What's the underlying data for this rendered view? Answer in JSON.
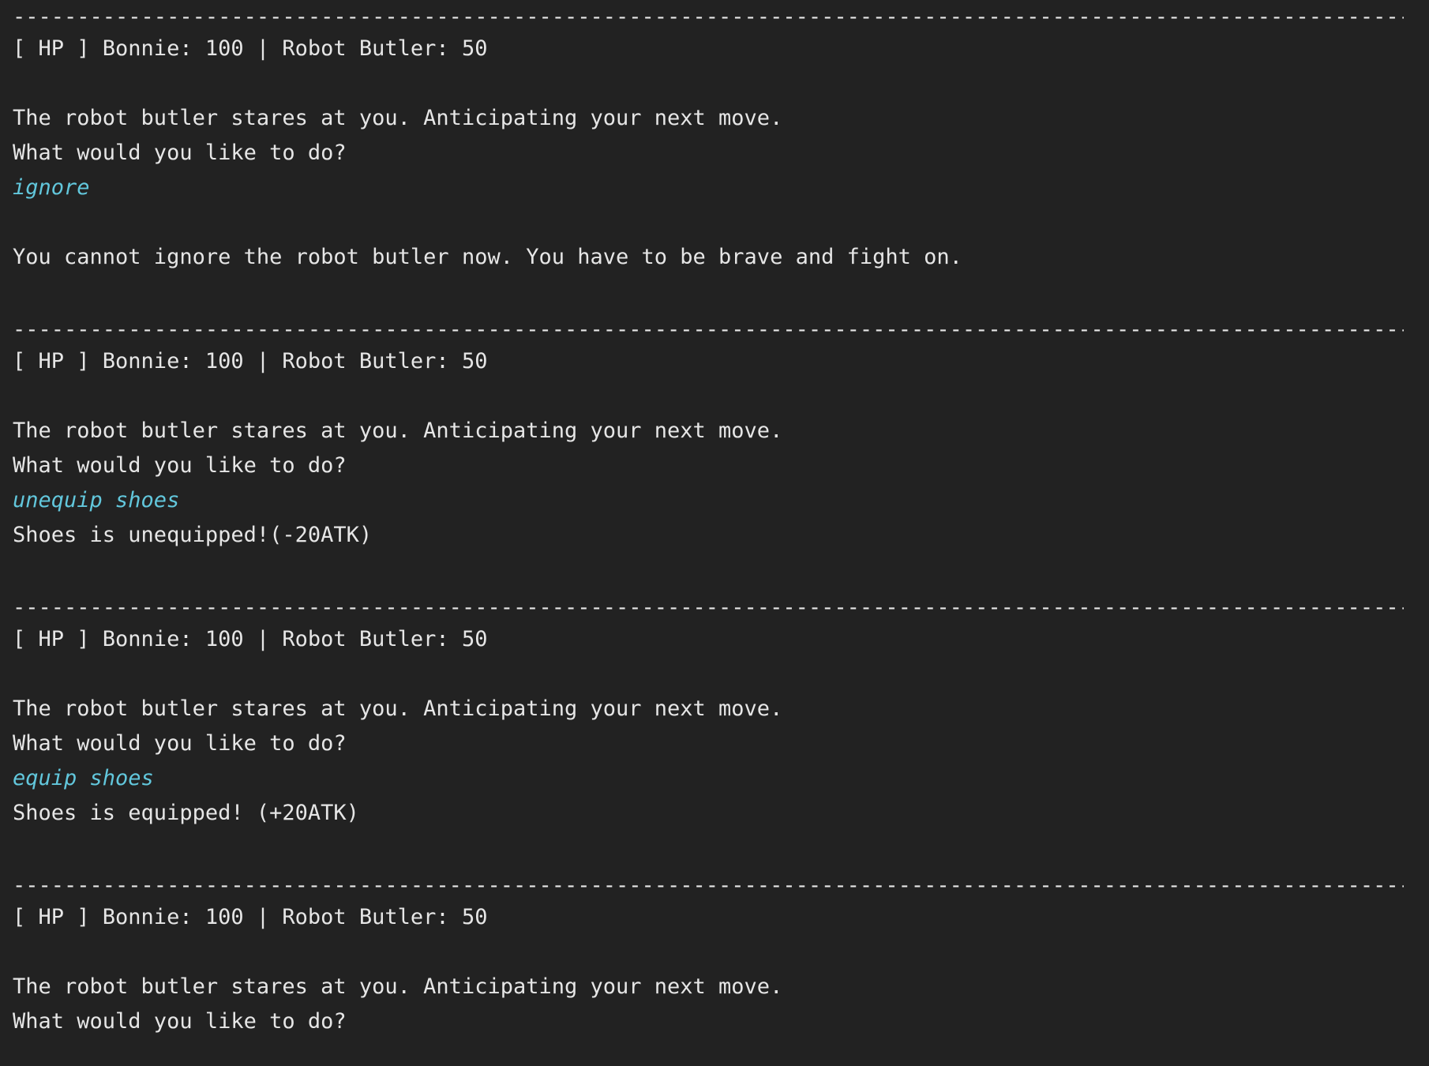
{
  "console": {
    "separator": "--------------------------------------------------------------------------------------------------------------------------------------------------------------------------------------------",
    "hp_status": "[ HP ] Bonnie: 100 | Robot Butler: 50",
    "prompt_stare": "The robot butler stares at you. Anticipating your next move.",
    "prompt_ask": "What would you like to do?",
    "turns": [
      {
        "input": "ignore",
        "response": "You cannot ignore the robot butler now. You have to be brave and fight on."
      },
      {
        "input": "unequip shoes",
        "response": "Shoes is unequipped!(-20ATK)"
      },
      {
        "input": "equip shoes",
        "response": "Shoes is equipped! (+20ATK)"
      }
    ]
  }
}
